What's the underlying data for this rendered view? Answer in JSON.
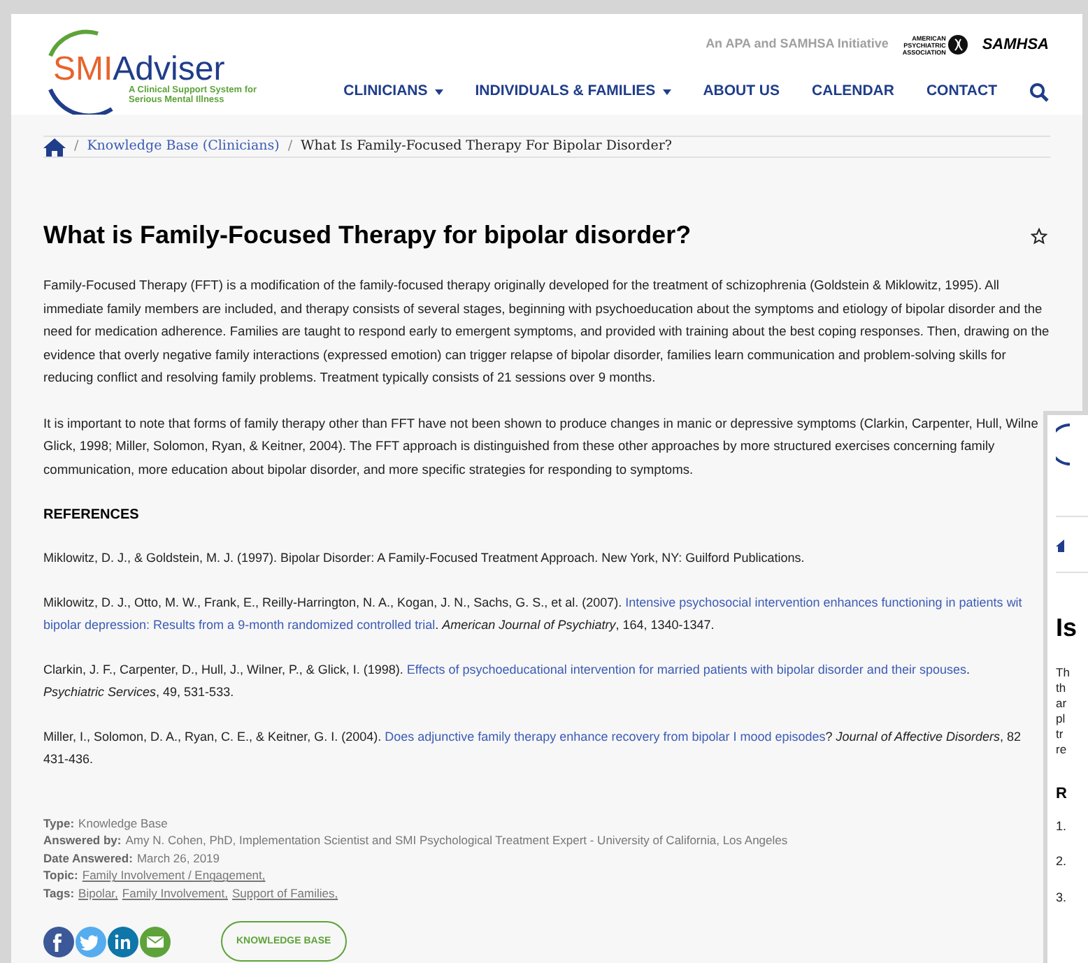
{
  "header": {
    "logo": {
      "brand_a": "SMI",
      "brand_b": "Adviser",
      "tagline": [
        "A Clinical Support System for",
        "Serious Mental Illness"
      ]
    },
    "initiative": "An APA and SAMHSA Initiative",
    "apa_logo": [
      "AMERICAN",
      "PSYCHIATRIC",
      "ASSOCIATION"
    ],
    "samhsa_logo": "SAMHSA",
    "nav": [
      {
        "label": "CLINICIANS",
        "dropdown": true
      },
      {
        "label": "INDIVIDUALS & FAMILIES",
        "dropdown": true
      },
      {
        "label": "ABOUT US",
        "dropdown": false
      },
      {
        "label": "CALENDAR",
        "dropdown": false
      },
      {
        "label": "CONTACT",
        "dropdown": false
      }
    ]
  },
  "breadcrumb": [
    {
      "separator": "/",
      "label": "Knowledge Base (Clinicians)",
      "kind": "link"
    },
    {
      "separator": "/",
      "label": "What Is Family-Focused Therapy For Bipolar Disorder?",
      "kind": "current"
    }
  ],
  "article": {
    "title": "What is Family-Focused Therapy for bipolar disorder?",
    "starred": false,
    "paragraphs": [
      [
        [
          {
            "kind": "plain",
            "text": "Family-Focused Therapy (FFT) is a modification of the family-focused therapy originally developed for the treatment of schizophrenia (Goldstein & Miklowitz, 1995). All"
          }
        ],
        [
          {
            "kind": "plain",
            "text": "immediate family members are included, and therapy consists of several stages, beginning with psychoeducation about the symptoms and etiology of bipolar disorder and the"
          }
        ],
        [
          {
            "kind": "plain",
            "text": "need for medication adherence. Families are taught to respond early to emergent symptoms, and provided with training about the best coping responses. Then, drawing on the"
          }
        ],
        [
          {
            "kind": "plain",
            "text": "evidence that overly negative family interactions (expressed emotion) can trigger relapse of bipolar disorder, families learn communication and problem-solving skills for"
          }
        ],
        [
          {
            "kind": "plain",
            "text": "reducing conflict and resolving family problems. Treatment typically consists of 21 sessions over 9 months."
          }
        ]
      ],
      [
        [
          {
            "kind": "plain",
            "text": "It is important to note that forms of family therapy other than FFT have not been shown to produce changes in manic or depressive symptoms (Clarkin, Carpenter, Hull, Wilne"
          }
        ],
        [
          {
            "kind": "plain",
            "text": "Glick, 1998; Miller, Solomon, Ryan, & Keitner, 2004). The FFT approach is distinguished from these other approaches by more structured exercises concerning family"
          }
        ],
        [
          {
            "kind": "plain",
            "text": "communication, more education about bipolar disorder, and more specific strategies for responding to symptoms."
          }
        ]
      ]
    ],
    "references_heading": "REFERENCES",
    "references": [
      [
        [
          {
            "kind": "plain",
            "text": "Miklowitz, D. J., & Goldstein, M. J. (1997). Bipolar Disorder: A Family-Focused Treatment Approach. New York, NY: Guilford Publications."
          }
        ]
      ],
      [
        [
          {
            "kind": "plain",
            "text": "Miklowitz, D. J., Otto, M. W., Frank, E., Reilly-Harrington, N. A., Kogan, J. N., Sachs, G. S., et al. (2007). "
          },
          {
            "kind": "link",
            "text": "Intensive psychosocial intervention enhances functioning in patients wit"
          }
        ],
        [
          {
            "kind": "link",
            "text": "bipolar depression: Results from a 9-month randomized controlled trial"
          },
          {
            "kind": "rich",
            "text": ". *American Journal of Psychiatry*, 164, 1340-1347."
          }
        ]
      ],
      [
        [
          {
            "kind": "plain",
            "text": "Clarkin, J. F., Carpenter, D., Hull, J., Wilner, P., & Glick, I. (1998). "
          },
          {
            "kind": "link",
            "text": "Effects of psychoeducational intervention for married patients with bipolar disorder and their spouses"
          },
          {
            "kind": "plain",
            "text": "."
          }
        ],
        [
          {
            "kind": "rich",
            "text": "*Psychiatric Services*, 49, 531-533."
          }
        ]
      ],
      [
        [
          {
            "kind": "plain",
            "text": "Miller, I., Solomon, D. A., Ryan, C. E., & Keitner, G. I. (2004). "
          },
          {
            "kind": "link",
            "text": "Does adjunctive family therapy enhance recovery from bipolar I mood episodes"
          },
          {
            "kind": "rich",
            "text": "? *Journal of Affective Disorders*, 82"
          }
        ],
        [
          {
            "kind": "plain",
            "text": "431-436."
          }
        ]
      ]
    ],
    "meta": [
      {
        "label": "Type:",
        "values": [
          {
            "text": "Knowledge Base",
            "kind": "plain"
          }
        ]
      },
      {
        "label": "Answered by:",
        "values": [
          {
            "text": "Amy N. Cohen, PhD, Implementation Scientist and SMI Psychological Treatment Expert - University of California, Los Angeles",
            "kind": "plain"
          }
        ]
      },
      {
        "label": "Date Answered:",
        "values": [
          {
            "text": "March 26, 2019",
            "kind": "plain"
          }
        ]
      },
      {
        "label": "Topic:",
        "values": [
          {
            "text": "Family Involvement / Engagement,",
            "kind": "link"
          }
        ]
      },
      {
        "label": "Tags:",
        "values": [
          {
            "text": "Bipolar,",
            "kind": "link"
          },
          {
            "text": "Family Involvement,",
            "kind": "link"
          },
          {
            "text": "Support of Families,",
            "kind": "link"
          }
        ]
      }
    ],
    "share": [
      {
        "kind": "facebook",
        "color": "#3b5998"
      },
      {
        "kind": "twitter",
        "color": "#55acee"
      },
      {
        "kind": "linkedin",
        "color": "#0e76a8"
      },
      {
        "kind": "email",
        "color": "#5ea33a"
      }
    ],
    "button": "KNOWLEDGE BASE"
  },
  "second_window": {
    "heading": "Is",
    "lines": [
      "Th",
      "th",
      "ar",
      "pl",
      "tr",
      "re"
    ],
    "subheading": "R",
    "numbers": [
      "1.",
      "2.",
      "3."
    ]
  }
}
